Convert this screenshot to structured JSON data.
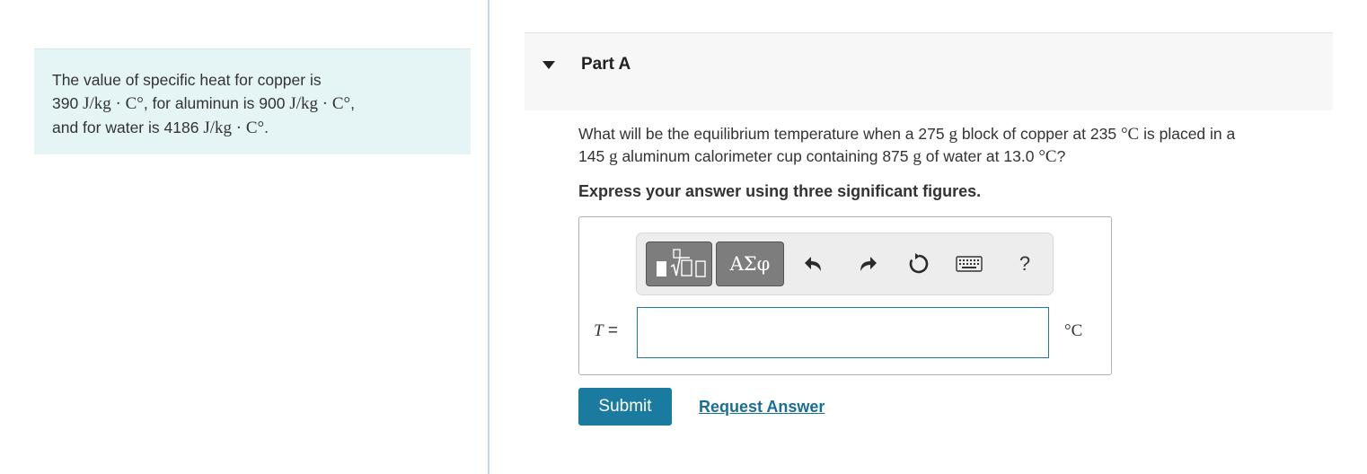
{
  "info": {
    "line1": "The value of specific heat for copper is",
    "copper_value": "390",
    "mid_text": ", for aluminun is",
    "aluminum_value": "900",
    "water_text": "and for water is",
    "water_value": "4186",
    "unit": "J/kg · C°"
  },
  "part": {
    "title": "Part A",
    "question": {
      "t1": "What will be the equilibrium temperature when a",
      "copper_mass": "275",
      "t2": "block of copper at",
      "copper_temp": "235",
      "t3": "is placed in a",
      "cup_mass": "145",
      "t4": "aluminum calorimeter cup containing",
      "water_mass": "875",
      "t5": "of water at",
      "water_temp": "13.0",
      "mass_unit": "g",
      "temp_unit": "°C"
    },
    "instruction": "Express your answer using three significant figures."
  },
  "answer": {
    "variable": "T",
    "equals": "=",
    "value": "",
    "unit": "°C"
  },
  "toolbar": {
    "greek_label": "ΑΣφ",
    "help_label": "?",
    "icons": [
      "templates-icon",
      "greek-symbols-icon",
      "undo-icon",
      "redo-icon",
      "reset-icon",
      "keyboard-icon",
      "help-icon"
    ]
  },
  "actions": {
    "submit_label": "Submit",
    "request_label": "Request Answer"
  },
  "colors": {
    "info_bg": "#e5f4f5",
    "accent": "#1a7aa0",
    "link": "#1a6e96",
    "input_border": "#2176a8"
  }
}
